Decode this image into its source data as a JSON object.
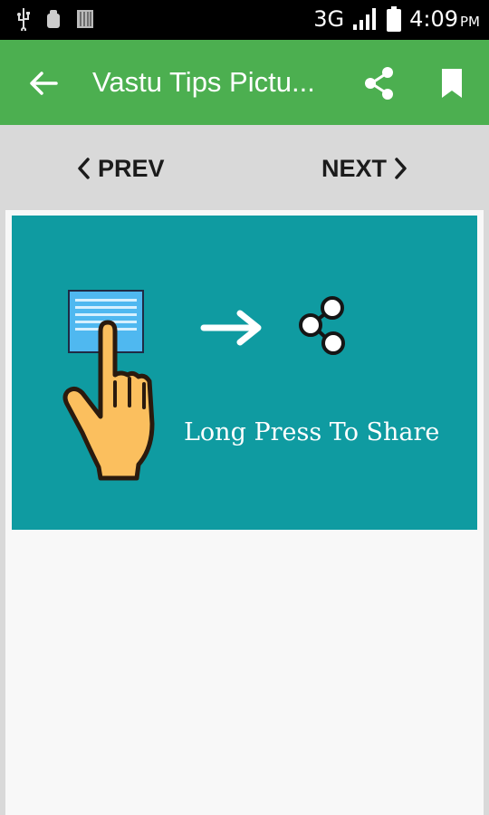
{
  "status_bar": {
    "network": "3G",
    "time": "4:09",
    "ampm": "PM"
  },
  "app_bar": {
    "title": "Vastu Tips Pictu...",
    "back_icon": "arrow-left-icon",
    "share_icon": "share-icon",
    "bookmark_icon": "bookmark-icon"
  },
  "navigation": {
    "prev_label": "PREV",
    "next_label": "NEXT"
  },
  "banner": {
    "text": "Long Press To Share",
    "background_color": "#0f9ba1"
  },
  "colors": {
    "app_bar": "#4caf50",
    "status_bar": "#000000",
    "page_background": "#d9d9d9"
  }
}
